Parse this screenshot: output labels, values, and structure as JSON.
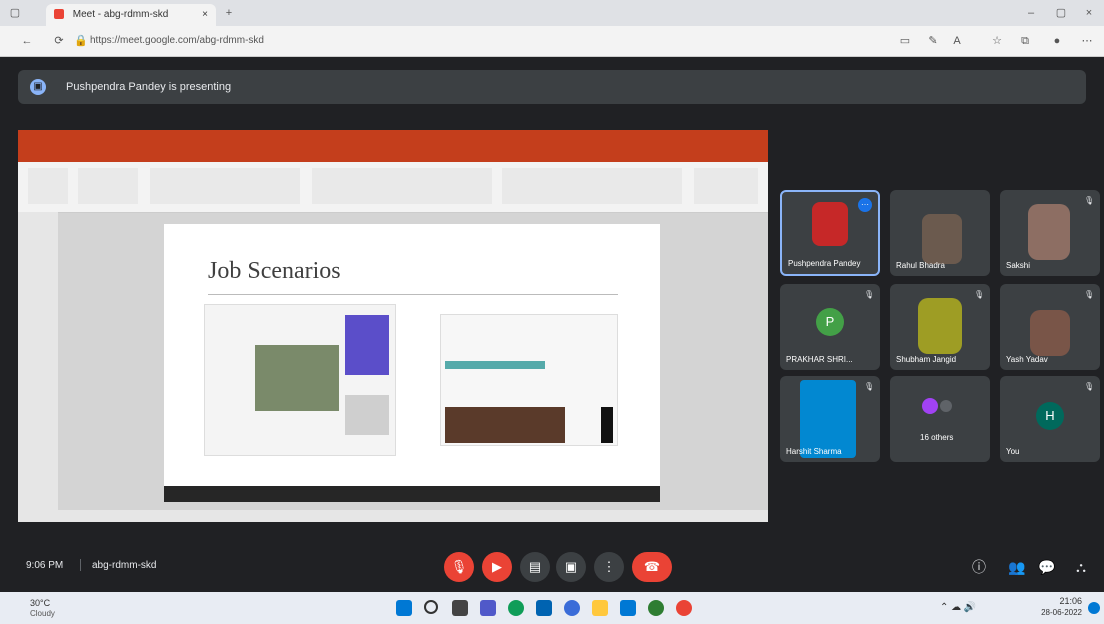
{
  "browser": {
    "tab_title": "Meet - abg-rdmm-skd",
    "url": "https://meet.google.com/abg-rdmm-skd"
  },
  "meet": {
    "presenting_text": "Pushpendra Pandey is presenting",
    "meeting_time": "9:06 PM",
    "meeting_code": "abg-rdmm-skd"
  },
  "slide": {
    "title": "Job Scenarios"
  },
  "participants": [
    {
      "name": "Pushpendra Pandey",
      "avatar_letter": "",
      "color": "#c62828"
    },
    {
      "name": "Rahul Bhadra",
      "avatar_letter": "",
      "color": "#6b5a4e"
    },
    {
      "name": "Sakshi",
      "avatar_letter": "",
      "color": "#8d6e63"
    },
    {
      "name": "PRAKHAR SHRI...",
      "avatar_letter": "P",
      "color": "#43a047"
    },
    {
      "name": "Shubham Jangid",
      "avatar_letter": "",
      "color": "#9e9d24"
    },
    {
      "name": "Yash Yadav",
      "avatar_letter": "",
      "color": "#795548"
    },
    {
      "name": "Harshit Sharma",
      "avatar_letter": "",
      "color": "#0288d1"
    },
    {
      "name": "16 others",
      "avatar_letter": "",
      "color": "#3c4043"
    },
    {
      "name": "You",
      "avatar_letter": "H",
      "color": "#00695c"
    }
  ],
  "taskbar": {
    "weather": "30°C",
    "weather_desc": "Cloudy",
    "clock_time": "21:06",
    "clock_date": "28-06-2022"
  }
}
